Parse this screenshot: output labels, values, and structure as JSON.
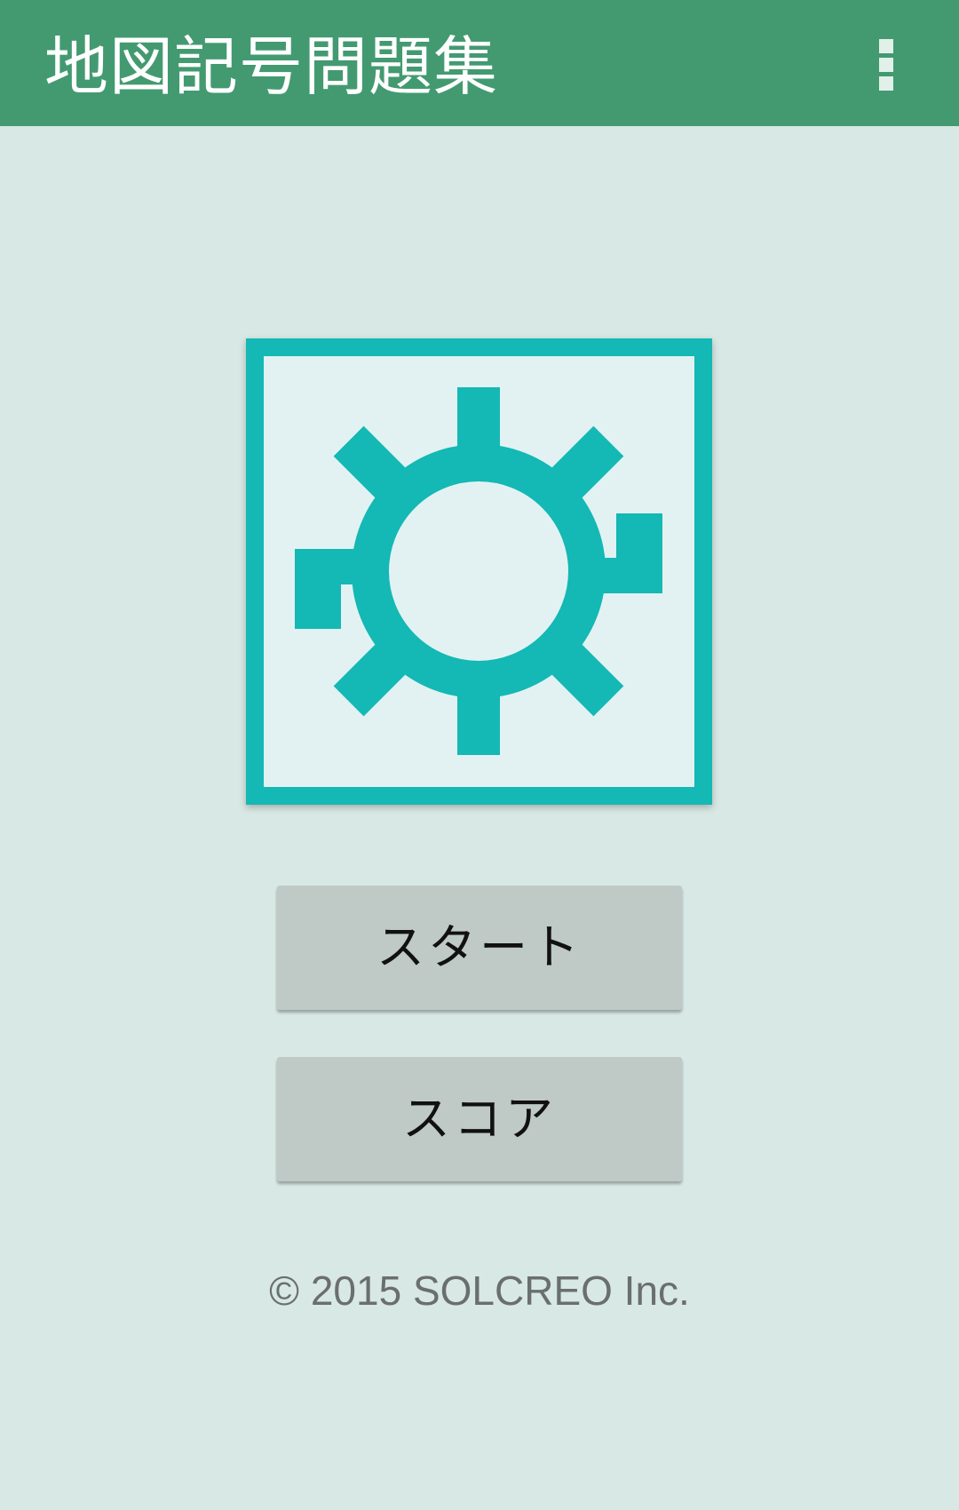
{
  "app_bar": {
    "title": "地図記号問題集",
    "overflow_icon": "more-vert-icon",
    "background": "#439a71"
  },
  "logo": {
    "icon": "map-symbol-gear-icon",
    "color": "#14b8b4",
    "fill": "#e2f2f3"
  },
  "buttons": {
    "start_label": "スタート",
    "score_label": "スコア"
  },
  "footer": {
    "copyright": "© 2015 SOLCREO Inc."
  }
}
